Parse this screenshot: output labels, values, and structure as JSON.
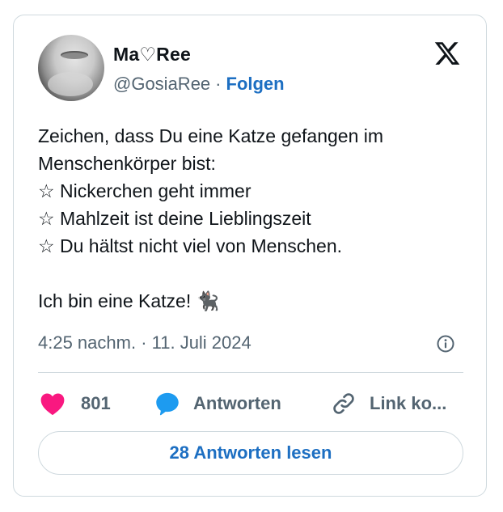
{
  "author": {
    "display_name": "Ma♡Ree",
    "handle": "@GosiaRee",
    "separator": "·",
    "follow_label": "Folgen"
  },
  "tweet": {
    "text": "Zeichen, dass Du eine Katze gefangen im Menschenkörper bist:\n☆ Nickerchen geht immer\n☆ Mahlzeit ist deine Lieblingszeit\n☆ Du hältst nicht viel von Menschen.\n\nIch bin eine Katze! 🐈‍⬛",
    "timestamp": "4:25 nachm. · 11. Juli 2024"
  },
  "actions": {
    "like_count": "801",
    "reply_label": "Antworten",
    "copy_link_label": "Link ko..."
  },
  "read_replies_label": "28 Antworten lesen",
  "icons": {
    "brand": "x-logo-icon",
    "info": "info-icon",
    "like": "heart-icon",
    "reply": "speech-bubble-icon",
    "link": "link-icon"
  },
  "colors": {
    "accent": "#1d6fc2",
    "like": "#f91880",
    "reply": "#1d9bf0",
    "secondary_text": "#536471",
    "border": "#cfd9de"
  }
}
